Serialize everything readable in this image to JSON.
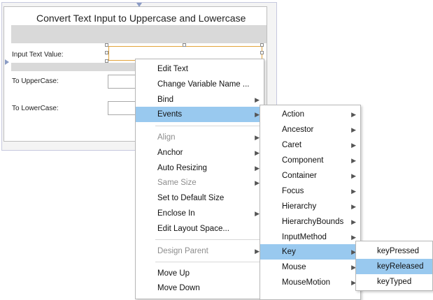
{
  "form": {
    "title": "Convert Text Input to Uppercase and Lowercase",
    "input_label": "Input Text Value:",
    "upper_label": "To UpperCase:",
    "lower_label": "To LowerCase:"
  },
  "context_menu": {
    "items": [
      {
        "label": "Edit Text",
        "enabled": true,
        "submenu": false
      },
      {
        "label": "Change Variable Name ...",
        "enabled": true,
        "submenu": false
      },
      {
        "label": "Bind",
        "enabled": true,
        "submenu": true
      },
      {
        "label": "Events",
        "enabled": true,
        "submenu": true,
        "highlighted": true
      },
      {
        "label": "Align",
        "enabled": false,
        "submenu": true
      },
      {
        "label": "Anchor",
        "enabled": true,
        "submenu": true
      },
      {
        "label": "Auto Resizing",
        "enabled": true,
        "submenu": true
      },
      {
        "label": "Same Size",
        "enabled": false,
        "submenu": true
      },
      {
        "label": "Set to Default Size",
        "enabled": true,
        "submenu": false
      },
      {
        "label": "Enclose In",
        "enabled": true,
        "submenu": true
      },
      {
        "label": "Edit Layout Space...",
        "enabled": true,
        "submenu": false
      },
      {
        "label": "Design Parent",
        "enabled": false,
        "submenu": true
      },
      {
        "label": "Move Up",
        "enabled": true,
        "submenu": false
      },
      {
        "label": "Move Down",
        "enabled": true,
        "submenu": false
      }
    ]
  },
  "events_menu": {
    "items": [
      {
        "label": "Action"
      },
      {
        "label": "Ancestor"
      },
      {
        "label": "Caret"
      },
      {
        "label": "Component"
      },
      {
        "label": "Container"
      },
      {
        "label": "Focus"
      },
      {
        "label": "Hierarchy"
      },
      {
        "label": "HierarchyBounds"
      },
      {
        "label": "InputMethod"
      },
      {
        "label": "Key",
        "highlighted": true
      },
      {
        "label": "Mouse"
      },
      {
        "label": "MouseMotion"
      }
    ]
  },
  "key_menu": {
    "items": [
      {
        "label": "keyPressed"
      },
      {
        "label": "keyReleased",
        "highlighted": true
      },
      {
        "label": "keyTyped"
      }
    ]
  },
  "icons": {
    "submenu_arrow": "▶",
    "guide_marker": "triangle"
  },
  "colors": {
    "highlight": "#99c9ef",
    "selection_border": "#e2a33a",
    "disabled_text": "#8d8d8d"
  }
}
